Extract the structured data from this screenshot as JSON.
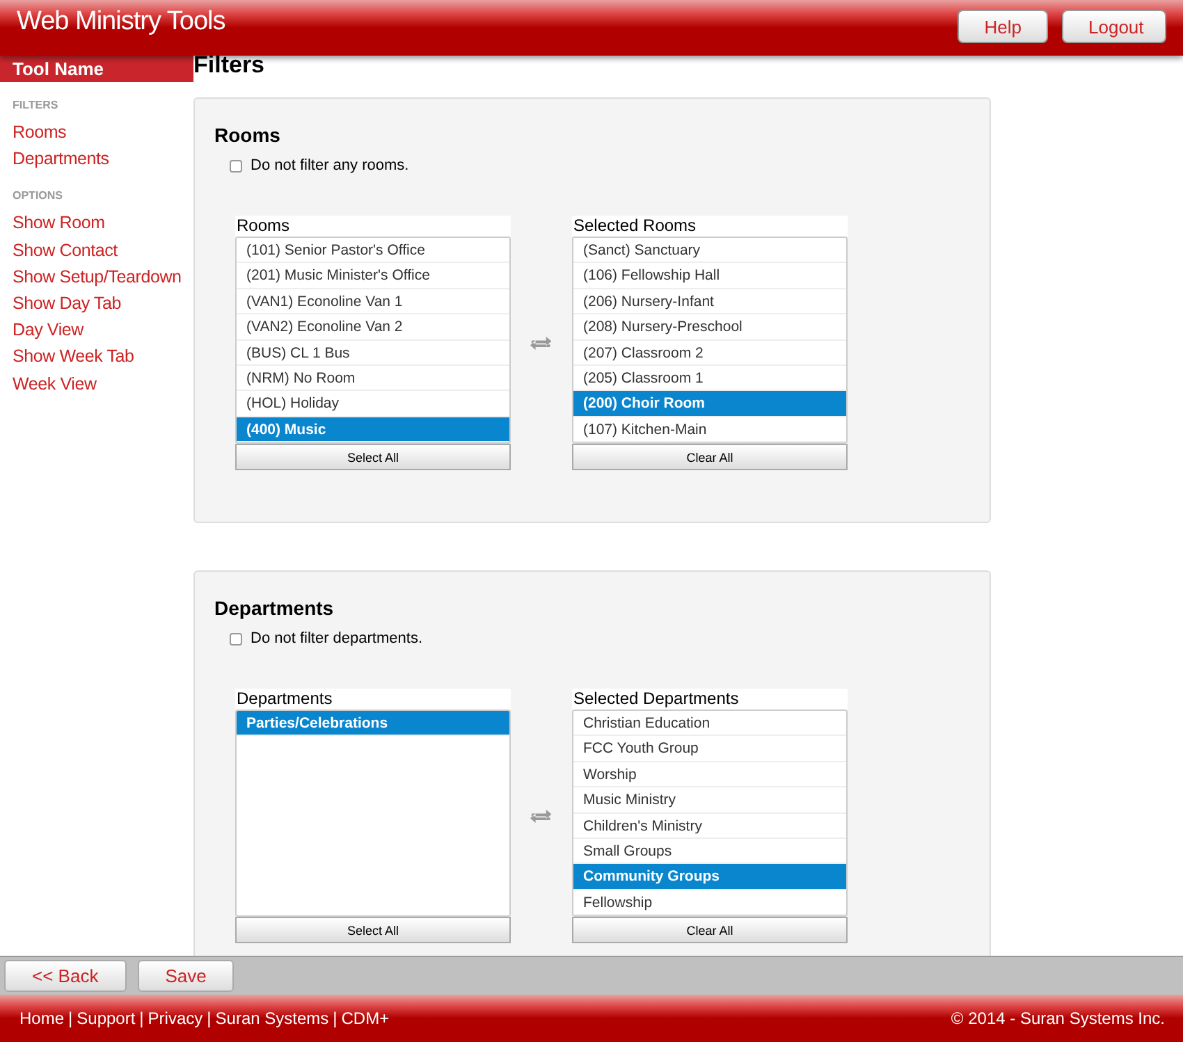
{
  "header": {
    "title": "Web Ministry Tools",
    "buttons": [
      "Help",
      "Logout"
    ]
  },
  "sidebar": {
    "tool_name": "Tool Name",
    "sections": [
      {
        "heading": "FILTERS",
        "items": [
          "Rooms",
          "Departments"
        ]
      },
      {
        "heading": "OPTIONS",
        "items": [
          "Show Room",
          "Show Contact",
          "Show Setup/Teardown",
          "Show Day Tab",
          "Day View",
          "Show Week Tab",
          "Week View"
        ]
      }
    ]
  },
  "page_title": "Filters",
  "panels": [
    {
      "title": "Rooms",
      "checkbox": {
        "label": "Do not filter any rooms.",
        "checked": false
      },
      "available": {
        "label": "Rooms",
        "button": "Select All",
        "items": [
          {
            "text": "(101) Senior Pastor's Office",
            "selected": false
          },
          {
            "text": "(201) Music Minister's Office",
            "selected": false
          },
          {
            "text": "(VAN1) Econoline Van 1",
            "selected": false
          },
          {
            "text": "(VAN2) Econoline Van 2",
            "selected": false
          },
          {
            "text": "(BUS) CL 1 Bus",
            "selected": false
          },
          {
            "text": "(NRM) No Room",
            "selected": false
          },
          {
            "text": "(HOL) Holiday",
            "selected": false
          },
          {
            "text": "(400) Music",
            "selected": true
          }
        ]
      },
      "chosen": {
        "label": "Selected Rooms",
        "button": "Clear All",
        "items": [
          {
            "text": "(Sanct) Sanctuary",
            "selected": false
          },
          {
            "text": "(106) Fellowship Hall",
            "selected": false
          },
          {
            "text": "(206) Nursery-Infant",
            "selected": false
          },
          {
            "text": "(208) Nursery-Preschool",
            "selected": false
          },
          {
            "text": "(207) Classroom 2",
            "selected": false
          },
          {
            "text": "(205) Classroom 1",
            "selected": false
          },
          {
            "text": "(200) Choir Room",
            "selected": true
          },
          {
            "text": "(107) Kitchen-Main",
            "selected": false
          }
        ]
      }
    },
    {
      "title": "Departments",
      "checkbox": {
        "label": "Do not filter departments.",
        "checked": false
      },
      "available": {
        "label": "Departments",
        "button": "Select All",
        "items": [
          {
            "text": "Parties/Celebrations",
            "selected": true
          }
        ]
      },
      "chosen": {
        "label": "Selected Departments",
        "button": "Clear All",
        "items": [
          {
            "text": "Christian Education",
            "selected": false
          },
          {
            "text": "FCC Youth Group",
            "selected": false
          },
          {
            "text": "Worship",
            "selected": false
          },
          {
            "text": "Music Ministry",
            "selected": false
          },
          {
            "text": "Children's Ministry",
            "selected": false
          },
          {
            "text": "Small Groups",
            "selected": false
          },
          {
            "text": "Community Groups",
            "selected": true
          },
          {
            "text": "Fellowship",
            "selected": false
          }
        ]
      }
    }
  ],
  "toolbar": {
    "buttons": [
      "<< Back",
      "Save"
    ]
  },
  "footer": {
    "links": [
      "Home",
      "Support",
      "Privacy",
      "Suran Systems",
      "CDM+"
    ],
    "separator": "|",
    "copyright": "© 2014 - Suran Systems Inc."
  }
}
